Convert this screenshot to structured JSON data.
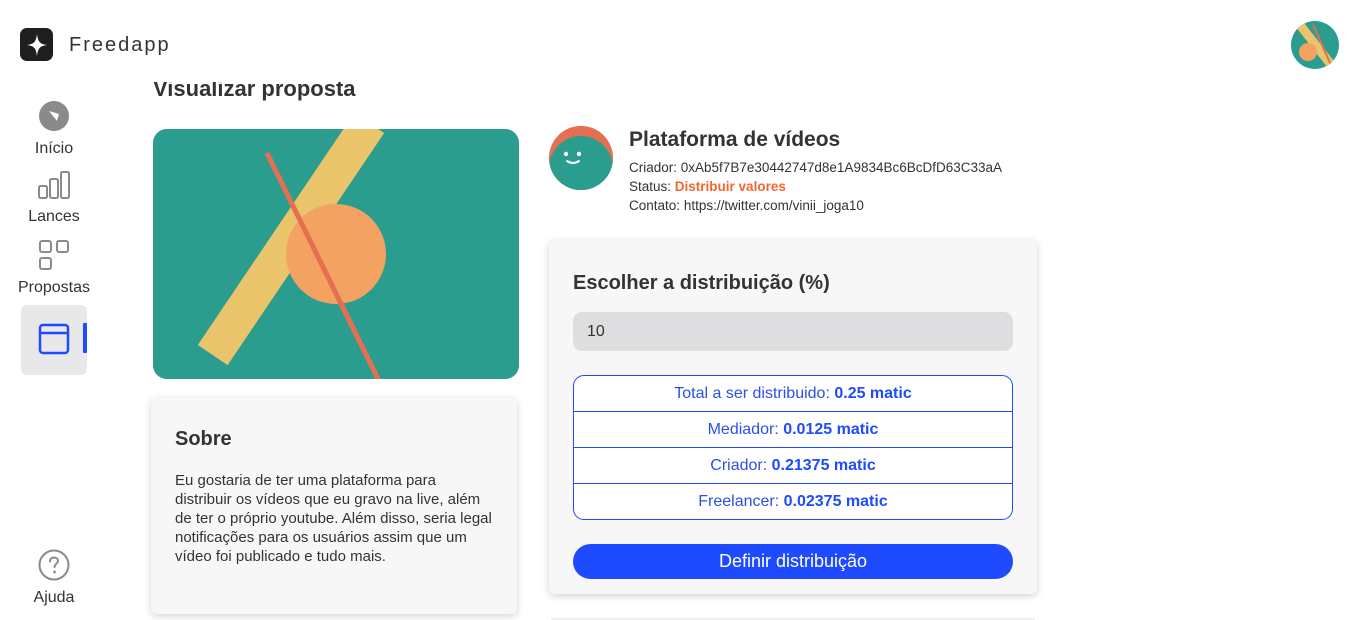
{
  "app": {
    "brand": "Freedapp"
  },
  "sidebar": {
    "items": [
      {
        "label": "Início",
        "icon": "compass-icon"
      },
      {
        "label": "Lances",
        "icon": "bar-chart-icon"
      },
      {
        "label": "Propostas",
        "icon": "grid-icon"
      },
      {
        "label": "",
        "icon": "window-icon",
        "active": true
      }
    ],
    "help": {
      "label": "Ajuda",
      "icon": "help-icon"
    }
  },
  "main": {
    "title": "Visualizar proposta",
    "about": {
      "title": "Sobre",
      "text": "Eu gostaria de ter uma plataforma para distribuir os vídeos que eu gravo na live, além de ter o próprio youtube. Além disso, seria legal notificações para os usuários assim que um vídeo foi publicado e tudo mais."
    },
    "project": {
      "title": "Plataforma de vídeos",
      "creator_label": "Criador:",
      "creator_value": "0xAb5f7B7e30442747d8e1A9834Bc6BcDfD63C33aA",
      "status_label": "Status:",
      "status_value": "Distribuir valores",
      "contact_label": "Contato:",
      "contact_value": "https://twitter.com/vinii_joga10"
    },
    "distribution": {
      "title": "Escolher a distribuição (%)",
      "input_value": "10",
      "rows": [
        {
          "label": "Total a ser distribuido:",
          "value": "0.25 matic"
        },
        {
          "label": "Mediador:",
          "value": "0.0125 matic"
        },
        {
          "label": "Criador:",
          "value": "0.21375 matic"
        },
        {
          "label": "Freelancer:",
          "value": "0.02375 matic"
        }
      ],
      "button_label": "Definir distribuição"
    }
  },
  "colors": {
    "accent": "#1e4bff",
    "status": "#f4662f",
    "teal": "#2a9d8f",
    "orange": "#f4a261",
    "yellow": "#e9c46a",
    "coral": "#e76f51"
  }
}
